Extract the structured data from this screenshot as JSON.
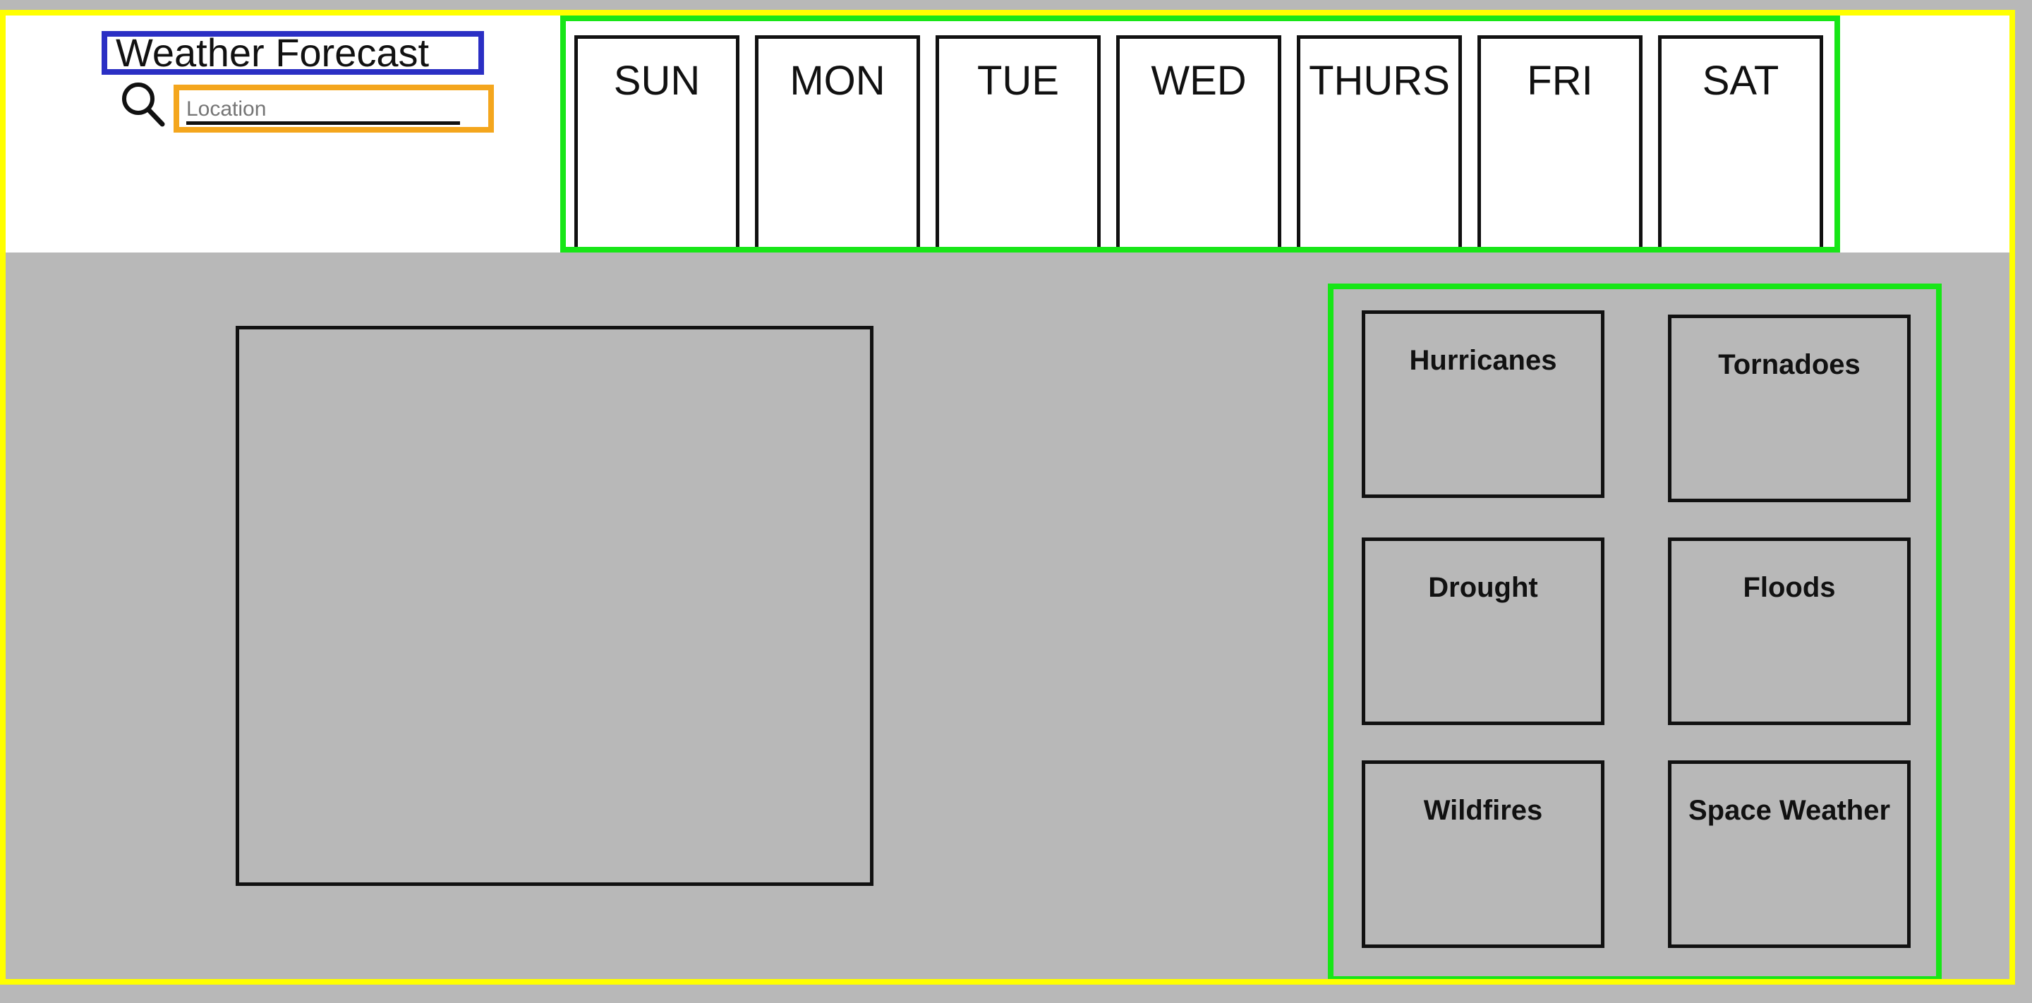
{
  "header": {
    "title": "Weather Forecast",
    "search": {
      "icon": "search-icon",
      "placeholder": "Location",
      "value": ""
    }
  },
  "days": [
    {
      "label": "SUN"
    },
    {
      "label": "MON"
    },
    {
      "label": "TUE"
    },
    {
      "label": "WED"
    },
    {
      "label": "THURS"
    },
    {
      "label": "FRI"
    },
    {
      "label": "SAT"
    }
  ],
  "hazards": [
    {
      "label": "Hurricanes"
    },
    {
      "label": "Tornadoes"
    },
    {
      "label": "Drought"
    },
    {
      "label": "Floods"
    },
    {
      "label": "Wildfires"
    },
    {
      "label": "Space Weather"
    }
  ],
  "colors": {
    "frame": "#ffff00",
    "title_border": "#2b2fc4",
    "search_border": "#f4a61d",
    "group_border": "#17e617",
    "background": "#b8b8b8"
  }
}
